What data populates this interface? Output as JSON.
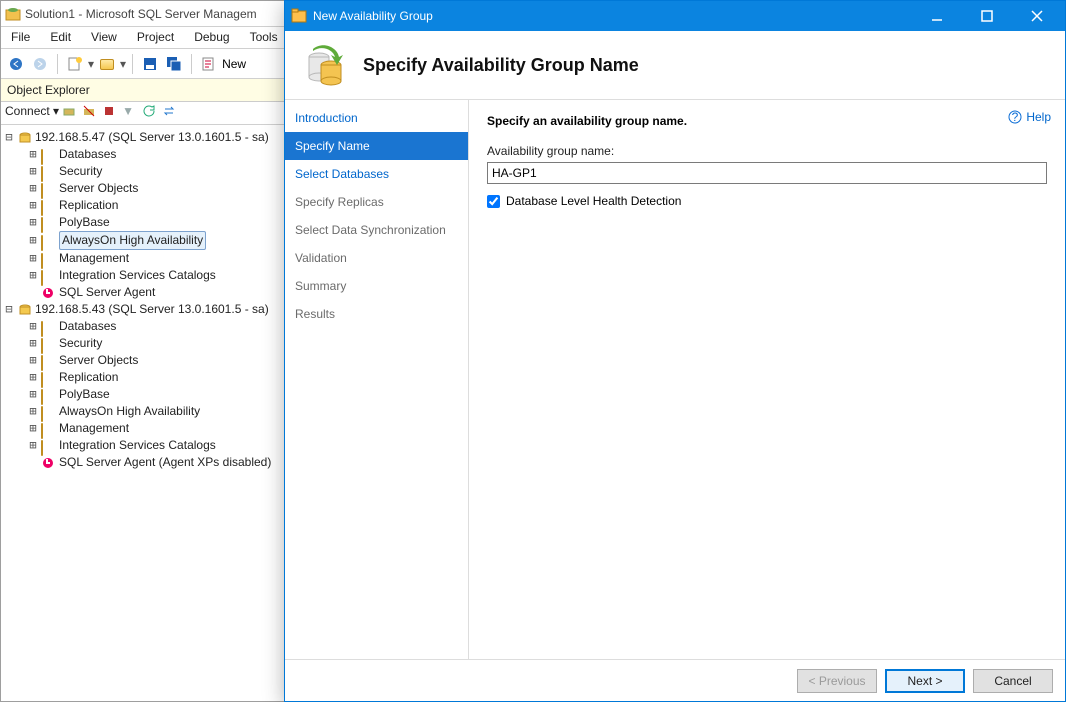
{
  "ssms": {
    "title": "Solution1 - Microsoft SQL Server Managem",
    "menus": [
      "File",
      "Edit",
      "View",
      "Project",
      "Debug",
      "Tools"
    ],
    "newq": "New",
    "panel": "Object Explorer",
    "connect": "Connect",
    "servers": [
      {
        "label": "192.168.5.47 (SQL Server 13.0.1601.5 - sa)",
        "children": [
          "Databases",
          "Security",
          "Server Objects",
          "Replication",
          "PolyBase",
          "AlwaysOn High Availability",
          "Management",
          "Integration Services Catalogs",
          "SQL Server Agent"
        ],
        "selected": "AlwaysOn High Availability"
      },
      {
        "label": "192.168.5.43 (SQL Server 13.0.1601.5 - sa)",
        "children": [
          "Databases",
          "Security",
          "Server Objects",
          "Replication",
          "PolyBase",
          "AlwaysOn High Availability",
          "Management",
          "Integration Services Catalogs",
          "SQL Server Agent (Agent XPs disabled)"
        ]
      }
    ]
  },
  "dialog": {
    "title": "New Availability Group",
    "heading": "Specify Availability Group Name",
    "steps": [
      {
        "label": "Introduction",
        "link": true
      },
      {
        "label": "Specify Name",
        "selected": true
      },
      {
        "label": "Select Databases",
        "link": true
      },
      {
        "label": "Specify Replicas"
      },
      {
        "label": "Select Data Synchronization"
      },
      {
        "label": "Validation"
      },
      {
        "label": "Summary"
      },
      {
        "label": "Results"
      }
    ],
    "help": "Help",
    "form": {
      "subtitle": "Specify an availability group name.",
      "name_label": "Availability group name:",
      "name_value": "HA-GP1",
      "check_label": "Database Level Health Detection",
      "check_checked": true
    },
    "buttons": {
      "prev": "< Previous",
      "next": "Next >",
      "cancel": "Cancel"
    }
  }
}
